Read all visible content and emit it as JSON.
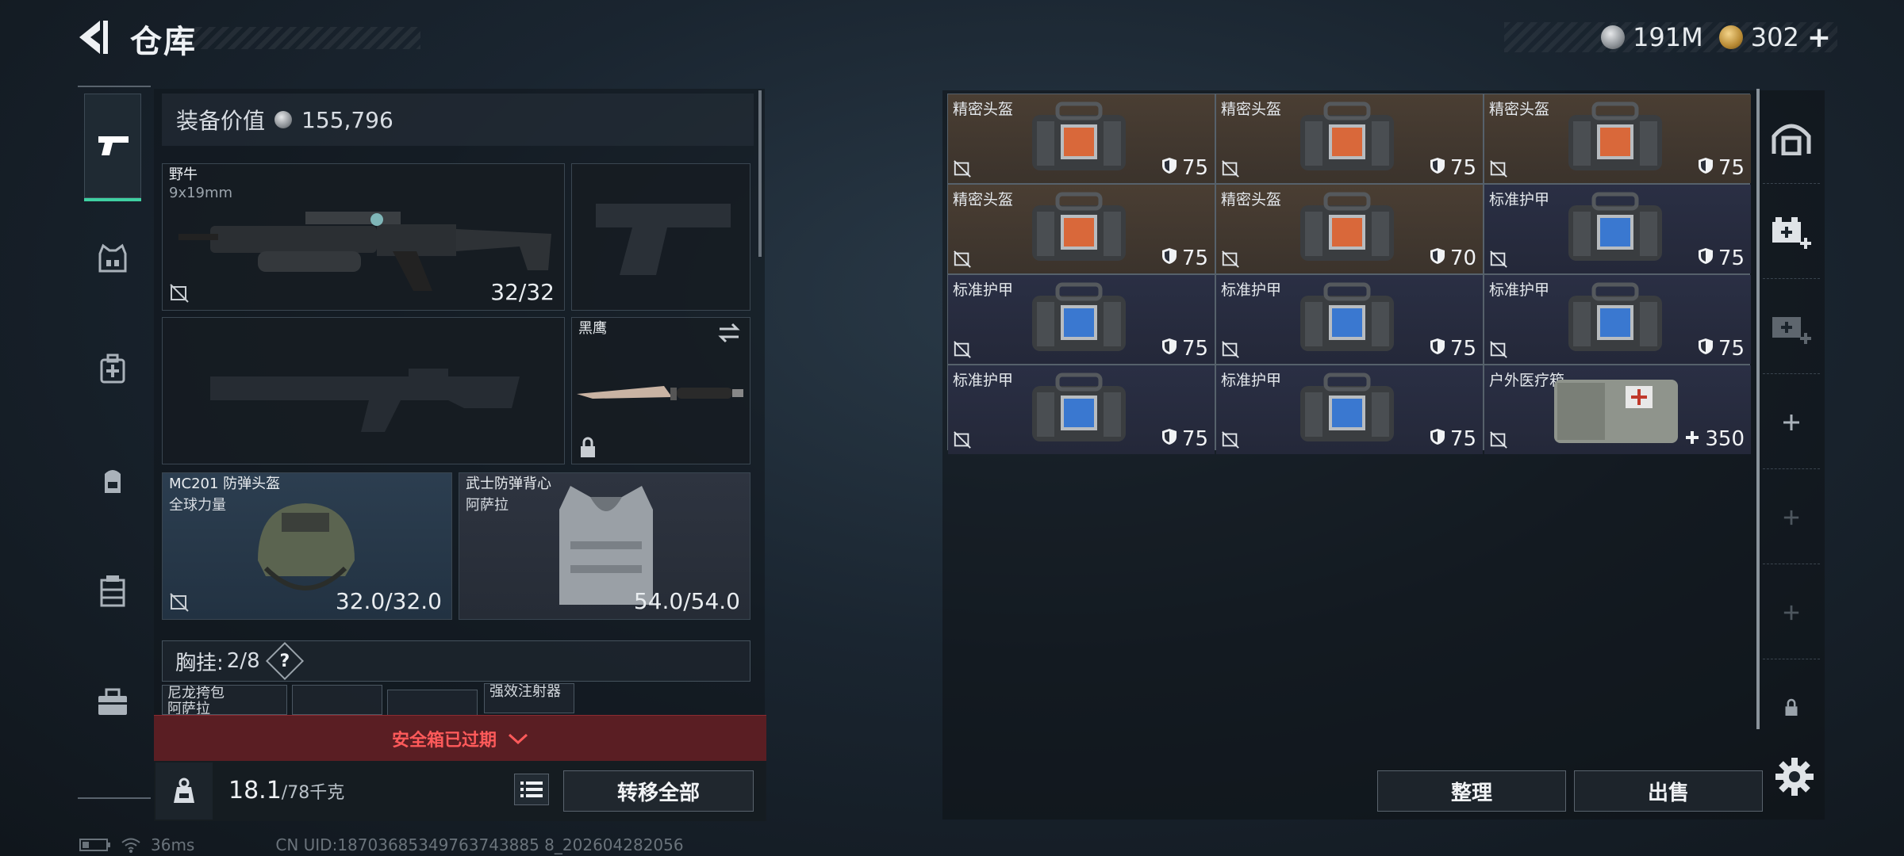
{
  "header": {
    "title": "仓库",
    "currency_silver": "191M",
    "currency_gold": "302",
    "gold_plus": "+"
  },
  "categories": [
    {
      "icon": "pistol-icon",
      "active": true
    },
    {
      "icon": "armor-vest-icon",
      "active": false
    },
    {
      "icon": "medkit-icon",
      "active": false
    },
    {
      "icon": "backpack-icon",
      "active": false
    },
    {
      "icon": "container-icon",
      "active": false
    },
    {
      "icon": "toolbox-icon",
      "active": false
    }
  ],
  "loadout": {
    "equip_value_label": "装备价值",
    "equip_value": "155,796",
    "primary_weapon": {
      "name": "野牛",
      "caliber": "9x19mm",
      "ammo": "32/32"
    },
    "melee": {
      "name": "黑鹰"
    },
    "helmet": {
      "name": "MC201 防弹头盔",
      "brand": "全球力量",
      "durability": "32.0/32.0"
    },
    "vest": {
      "name": "武士防弹背心",
      "brand": "阿萨拉",
      "durability": "54.0/54.0"
    },
    "chest_rig_label": "胸挂:",
    "chest_rig_count": "2/8",
    "help": "?",
    "rig_items": [
      {
        "name": "尼龙挎包",
        "brand": "阿萨拉"
      },
      {
        "name": ""
      },
      {
        "name": ""
      },
      {
        "name": "强效注射器"
      }
    ]
  },
  "safe_box": {
    "text": "安全箱已过期"
  },
  "bottom": {
    "weight_current": "18.1",
    "weight_max": "/78千克",
    "transfer_all": "转移全部"
  },
  "status": {
    "ping": "36ms",
    "uid": "CN UID:18703685349763743885 8_202604282056"
  },
  "stash": {
    "items": [
      {
        "name": "精密头盔",
        "value": "75",
        "type": "helmet-case",
        "color": "#3f362e"
      },
      {
        "name": "精密头盔",
        "value": "75",
        "type": "helmet-case",
        "color": "#3f362e"
      },
      {
        "name": "精密头盔",
        "value": "75",
        "type": "helmet-case",
        "color": "#3f362e"
      },
      {
        "name": "精密头盔",
        "value": "75",
        "type": "helmet-case",
        "color": "#3f362e"
      },
      {
        "name": "精密头盔",
        "value": "70",
        "type": "helmet-case",
        "color": "#3f362e"
      },
      {
        "name": "标准护甲",
        "value": "75",
        "type": "armor-case",
        "color": "#262a3c"
      },
      {
        "name": "标准护甲",
        "value": "75",
        "type": "armor-case",
        "color": "#262a3c"
      },
      {
        "name": "标准护甲",
        "value": "75",
        "type": "armor-case",
        "color": "#262a3c"
      },
      {
        "name": "标准护甲",
        "value": "75",
        "type": "armor-case",
        "color": "#262a3c"
      },
      {
        "name": "标准护甲",
        "value": "75",
        "type": "armor-case",
        "color": "#262a3c"
      },
      {
        "name": "标准护甲",
        "value": "75",
        "type": "armor-case",
        "color": "#262a3c"
      },
      {
        "name": "户外医疗箱",
        "value": "350",
        "type": "medkit",
        "color": "#262a3c"
      }
    ],
    "tidy": "整理",
    "sell": "出售"
  },
  "rail": [
    {
      "icon": "bunker-icon"
    },
    {
      "icon": "add-medical-case-icon"
    },
    {
      "icon": "add-medical-case-dim-icon"
    },
    {
      "icon": "plus-icon"
    },
    {
      "icon": "plus-dim-icon"
    },
    {
      "icon": "plus-dim-icon"
    },
    {
      "icon": "lock-icon"
    }
  ]
}
